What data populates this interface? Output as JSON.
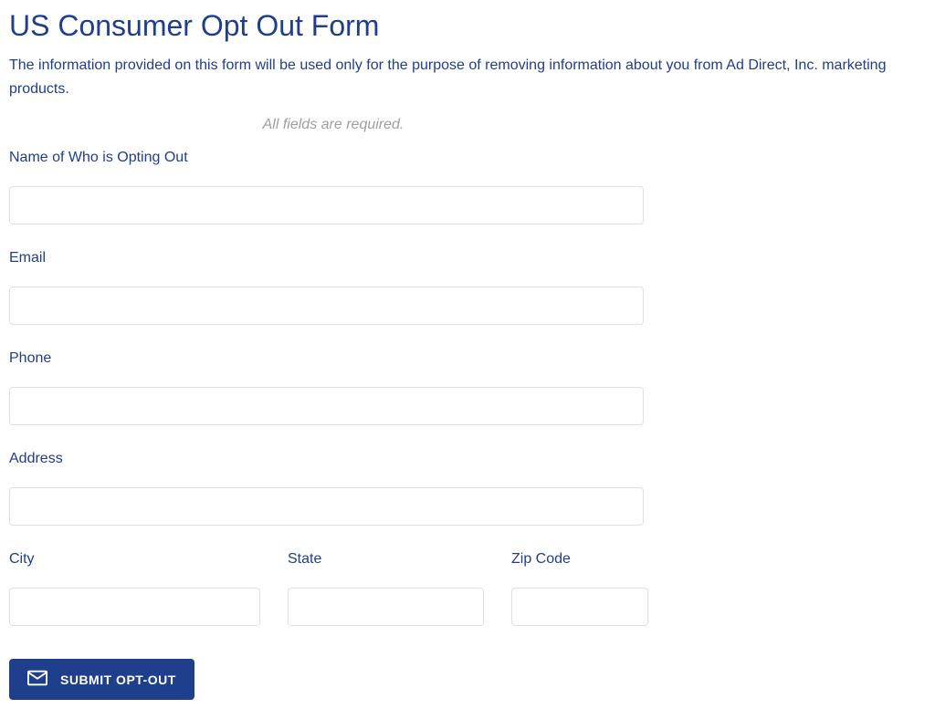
{
  "header": {
    "title": "US Consumer Opt Out Form",
    "description": "The information provided on this form will be used only for the purpose of removing information about you from Ad Direct, Inc. marketing products.",
    "required_note": "All fields are required."
  },
  "form": {
    "name": {
      "label": "Name of Who is Opting Out",
      "value": ""
    },
    "email": {
      "label": "Email",
      "value": ""
    },
    "phone": {
      "label": "Phone",
      "value": ""
    },
    "address": {
      "label": "Address",
      "value": ""
    },
    "city": {
      "label": "City",
      "value": ""
    },
    "state": {
      "label": "State",
      "value": ""
    },
    "zip": {
      "label": "Zip Code",
      "value": ""
    }
  },
  "submit": {
    "label": "SUBMIT OPT-OUT"
  }
}
